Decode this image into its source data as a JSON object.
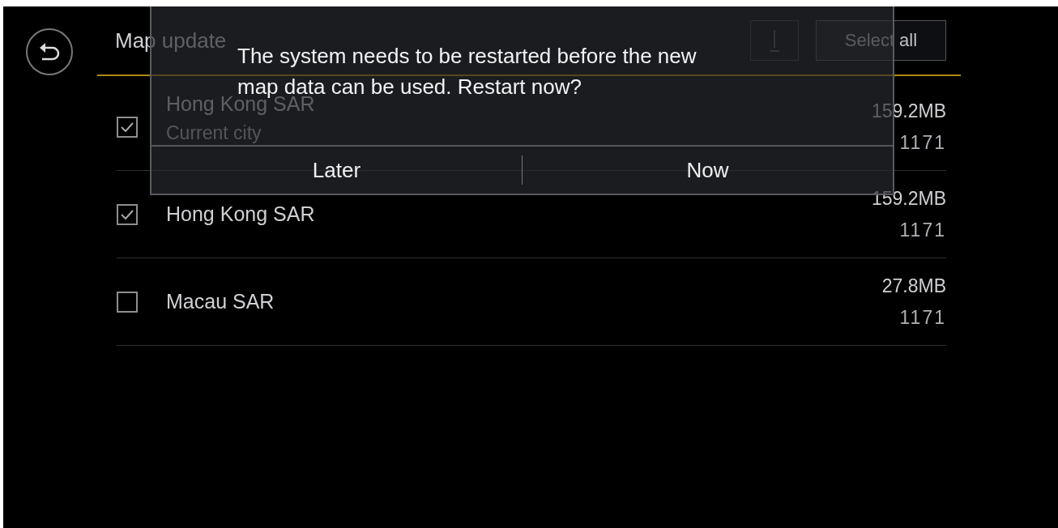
{
  "header": {
    "title": "Map update",
    "select_all": "Select all"
  },
  "regions": [
    {
      "name": "Hong Kong SAR",
      "subtitle": "Current city",
      "size": "159.2MB",
      "version": "1171",
      "checked": true
    },
    {
      "name": "Hong Kong SAR",
      "size": "159.2MB",
      "version": "1171",
      "checked": true
    },
    {
      "name": "Macau SAR",
      "size": "27.8MB",
      "version": "1171",
      "checked": false
    }
  ],
  "dialog": {
    "message": "The system needs to be restarted before the new map data can be used. Restart now?",
    "buttons": [
      "Later",
      "Now"
    ]
  }
}
